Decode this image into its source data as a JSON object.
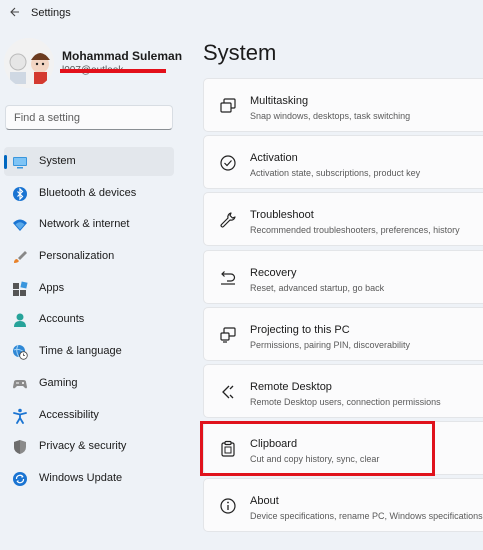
{
  "window": {
    "title": "Settings"
  },
  "profile": {
    "name": "Mohammad Suleman",
    "email": "l007@outlook"
  },
  "search": {
    "placeholder": "Find a setting"
  },
  "nav": [
    {
      "label": "System",
      "icon": "system-icon",
      "active": true
    },
    {
      "label": "Bluetooth & devices",
      "icon": "bluetooth-icon"
    },
    {
      "label": "Network & internet",
      "icon": "wifi-icon"
    },
    {
      "label": "Personalization",
      "icon": "brush-icon"
    },
    {
      "label": "Apps",
      "icon": "apps-icon"
    },
    {
      "label": "Accounts",
      "icon": "person-icon"
    },
    {
      "label": "Time & language",
      "icon": "globe-clock-icon"
    },
    {
      "label": "Gaming",
      "icon": "gamepad-icon"
    },
    {
      "label": "Accessibility",
      "icon": "accessibility-icon"
    },
    {
      "label": "Privacy & security",
      "icon": "shield-icon"
    },
    {
      "label": "Windows Update",
      "icon": "update-icon"
    }
  ],
  "main": {
    "title": "System",
    "cards": [
      {
        "title": "Multitasking",
        "desc": "Snap windows, desktops, task switching",
        "icon": "multitasking-icon"
      },
      {
        "title": "Activation",
        "desc": "Activation state, subscriptions, product key",
        "icon": "check-circle-icon"
      },
      {
        "title": "Troubleshoot",
        "desc": "Recommended troubleshooters, preferences, history",
        "icon": "wrench-icon"
      },
      {
        "title": "Recovery",
        "desc": "Reset, advanced startup, go back",
        "icon": "recovery-icon"
      },
      {
        "title": "Projecting to this PC",
        "desc": "Permissions, pairing PIN, discoverability",
        "icon": "projecting-icon"
      },
      {
        "title": "Remote Desktop",
        "desc": "Remote Desktop users, connection permissions",
        "icon": "remote-desktop-icon"
      },
      {
        "title": "Clipboard",
        "desc": "Cut and copy history, sync, clear",
        "icon": "clipboard-icon"
      },
      {
        "title": "About",
        "desc": "Device specifications, rename PC, Windows specifications",
        "icon": "info-icon"
      }
    ]
  },
  "colors": {
    "accent": "#0067c0",
    "highlight": "#e0121c",
    "background": "#eef2f7"
  }
}
